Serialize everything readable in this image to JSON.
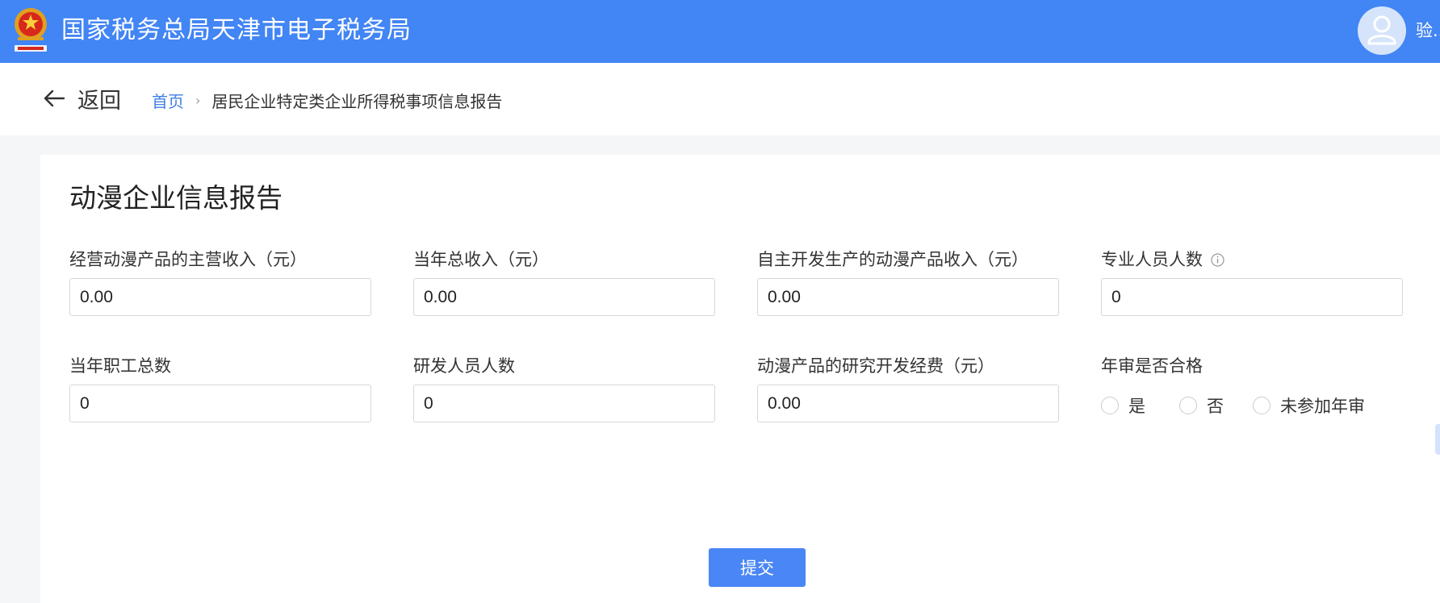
{
  "header": {
    "site_title": "国家税务总局天津市电子税务局",
    "username": "验...",
    "logo_icon": "tax-emblem-icon",
    "avatar_icon": "user-avatar-icon"
  },
  "nav": {
    "back_label": "返回",
    "back_icon": "arrow-left-icon",
    "breadcrumb_home": "首页",
    "breadcrumb_separator": "›",
    "breadcrumb_current": "居民企业特定类企业所得税事项信息报告"
  },
  "form": {
    "title": "动漫企业信息报告",
    "fields": [
      {
        "label": "经营动漫产品的主营收入（元）",
        "value": "0.00"
      },
      {
        "label": "当年总收入（元）",
        "value": "0.00"
      },
      {
        "label": "自主开发生产的动漫产品收入（元）",
        "value": "0.00"
      },
      {
        "label": "专业人员人数",
        "value": "0",
        "info_icon": "info-circle-icon"
      },
      {
        "label": "当年职工总数",
        "value": "0"
      },
      {
        "label": "研发人员人数",
        "value": "0"
      },
      {
        "label": "动漫产品的研究开发经费（元）",
        "value": "0.00"
      }
    ],
    "annual_review": {
      "label": "年审是否合格",
      "options": [
        "是",
        "否",
        "未参加年审"
      ]
    },
    "submit_label": "提交"
  },
  "colors": {
    "header_bg": "#4285f4",
    "primary": "#4a86f5",
    "link": "#3f7fe7",
    "page_bg": "#f5f6f8"
  }
}
